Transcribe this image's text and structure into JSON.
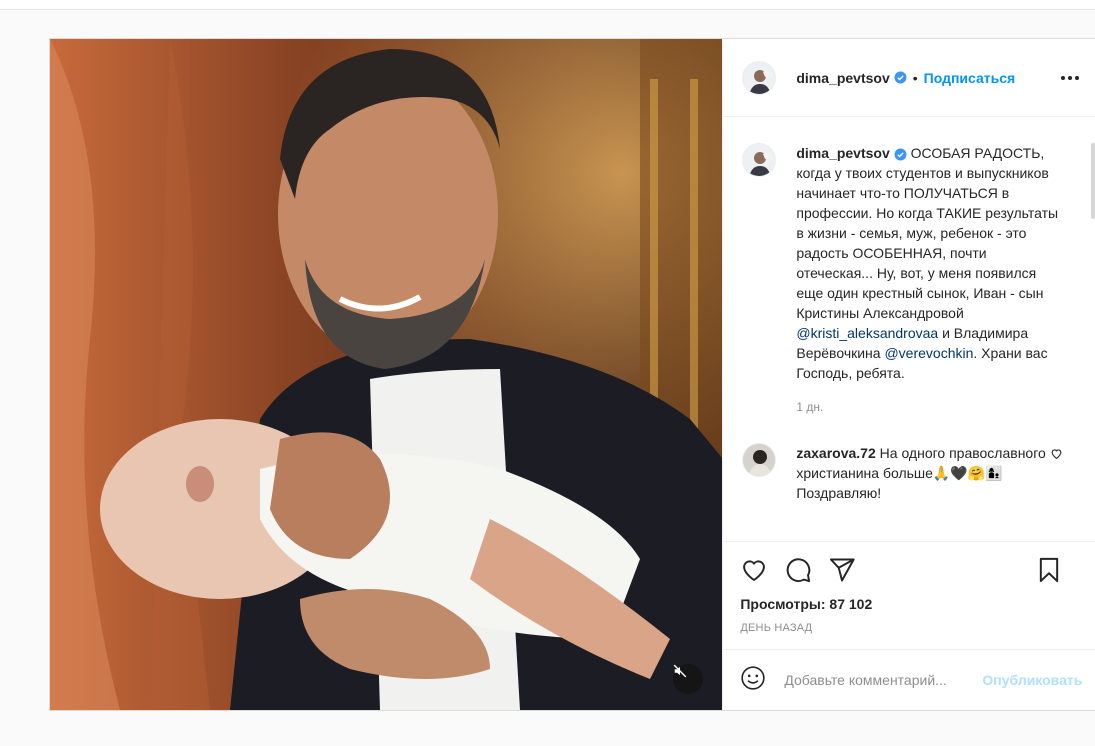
{
  "post": {
    "author": "dima_pevtsov",
    "separator": "•",
    "follow_label": "Подписаться",
    "caption_lines": {
      "text_before_mention1": " ОСОБАЯ РАДОСТЬ, когда у твоих студентов и выпускников начинает что-то ПОЛУЧАТЬСЯ в профессии. Но когда ТАКИЕ результаты в жизни - семья, муж, ребенок - это радость ОСОБЕННАЯ, почти отеческая... Ну, вот, у меня появился еще один крестный сынок, Иван - сын Кристины Александровой ",
      "mention1": "@kristi_aleksandrovaa",
      "text_between": " и Владимира Верёвочкина ",
      "mention2": "@verevochkin",
      "text_after": ". Храни вас Господь, ребята."
    },
    "time": "1 дн.",
    "comments": [
      {
        "user": "zaxarova.72",
        "text": " На одного православного христианина больше🙏🖤🤗👩‍👦 Поздравляю!"
      }
    ],
    "views_label": "Просмотры: 87 102",
    "posted_ago": "ДЕНЬ НАЗАД",
    "add_comment_placeholder": "Добавьте комментарий...",
    "publish_label": "Опубликовать"
  },
  "icons": {
    "like": "heart-icon",
    "comment": "comment-bubble-icon",
    "share": "paper-plane-icon",
    "save": "bookmark-icon",
    "emoji": "smiley-icon",
    "mute": "speaker-muted-icon",
    "verified": "verified-badge-icon",
    "more": "more-options-icon"
  },
  "colors": {
    "link_blue": "#0095f6",
    "verified_blue": "#3897f0",
    "mention": "#00376b",
    "muted_text": "#8e8e8e",
    "publish_disabled": "#b2dffc"
  }
}
